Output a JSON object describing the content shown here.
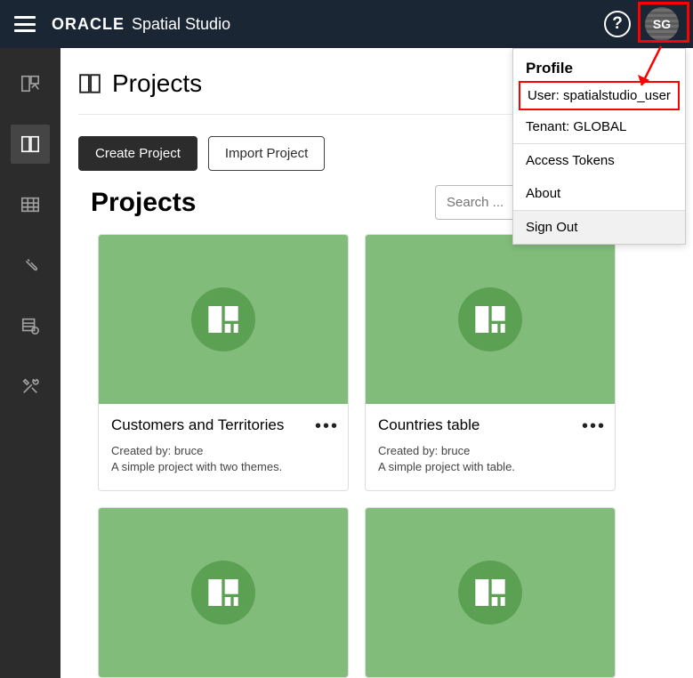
{
  "header": {
    "brand_logo": "ORACLE",
    "brand_app": "Spatial Studio",
    "avatar_initials": "SG"
  },
  "breadcrumb": {
    "title": "Projects"
  },
  "toolbar": {
    "create_label": "Create Project",
    "import_label": "Import Project"
  },
  "section": {
    "title": "Projects",
    "search_placeholder": "Search ..."
  },
  "projects": [
    {
      "title": "Customers and Territories",
      "creator": "Created by: bruce",
      "desc": "A simple project with two themes."
    },
    {
      "title": "Countries table",
      "creator": "Created by: bruce",
      "desc": "A simple project with table."
    },
    {
      "title": "",
      "creator": "",
      "desc": ""
    },
    {
      "title": "",
      "creator": "",
      "desc": ""
    }
  ],
  "profile_menu": {
    "header": "Profile",
    "user_label": "User: spatialstudio_user",
    "tenant_label": "Tenant: GLOBAL",
    "tokens_label": "Access Tokens",
    "about_label": "About",
    "signout_label": "Sign Out"
  }
}
